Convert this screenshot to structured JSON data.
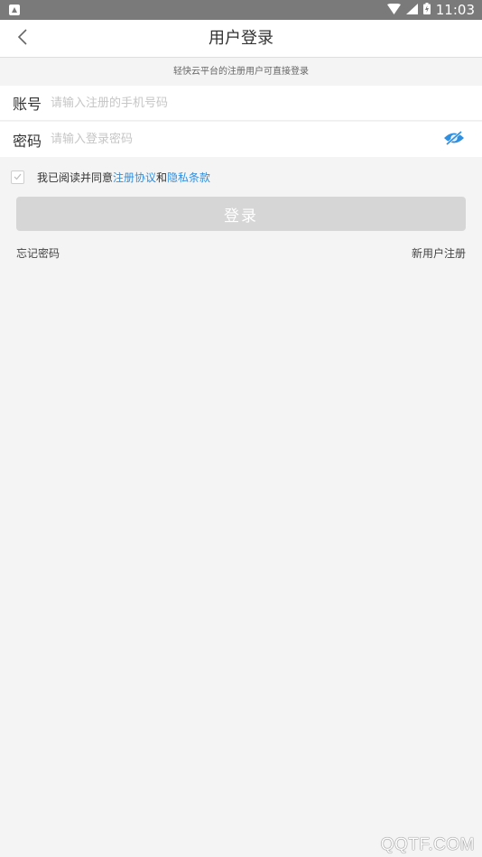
{
  "status_bar": {
    "time": "11:03",
    "icons": [
      "notification-icon",
      "wifi-icon",
      "signal-icon",
      "battery-icon"
    ]
  },
  "header": {
    "title": "用户登录",
    "back_icon": "chevron-left-icon"
  },
  "hint": "轻快云平台的注册用户可直接登录",
  "account": {
    "label": "账号",
    "placeholder": "请输入注册的手机号码",
    "value": ""
  },
  "password": {
    "label": "密码",
    "placeholder": "请输入登录密码",
    "value": "",
    "toggle_icon": "eye-hidden-icon"
  },
  "agreement": {
    "prefix": "我已阅读并同意",
    "terms_link": "注册协议",
    "and": "和",
    "privacy_link": "隐私条款",
    "checked": false
  },
  "login_button": "登录",
  "links": {
    "forgot": "忘记密码",
    "register": "新用户注册"
  },
  "watermark": "QQTF.COM",
  "colors": {
    "accent": "#2f8fe0",
    "background": "#f4f4f4",
    "button_disabled": "#d6d6d6",
    "status_bar": "#7a7a7a"
  }
}
